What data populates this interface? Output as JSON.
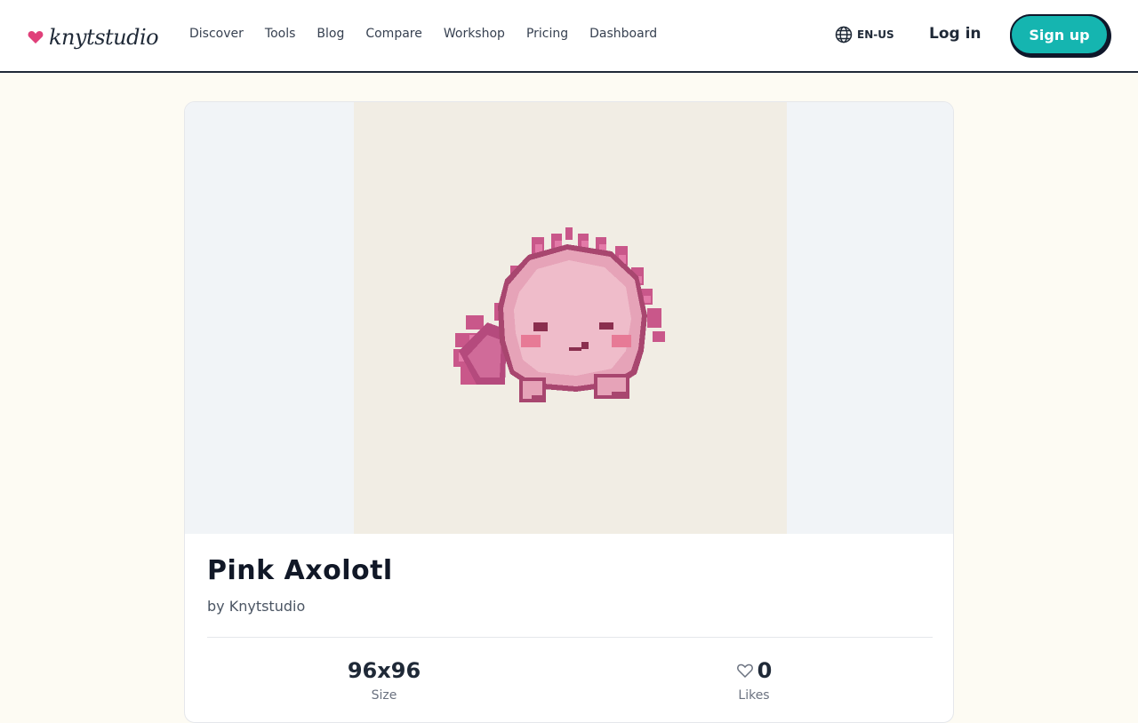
{
  "header": {
    "brand": "knytstudio",
    "nav": [
      "Discover",
      "Tools",
      "Blog",
      "Compare",
      "Workshop",
      "Pricing",
      "Dashboard"
    ],
    "locale": "EN-US",
    "login_label": "Log in",
    "signup_label": "Sign up"
  },
  "artwork": {
    "title": "Pink Axolotl",
    "byline": "by Knytstudio"
  },
  "stats": {
    "size_value": "96x96",
    "size_label": "Size",
    "likes_value": "0",
    "likes_label": "Likes"
  },
  "colors": {
    "accent": "#15b5b0",
    "brand_heart": "#e0407a",
    "page_bg": "#fdfbf3"
  }
}
